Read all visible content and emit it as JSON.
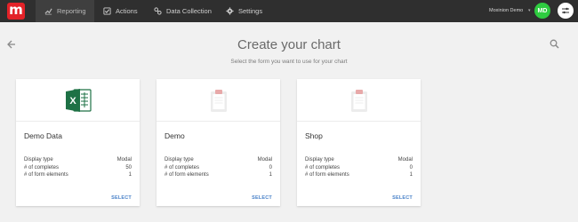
{
  "nav": {
    "logo_letter": "m",
    "tabs": [
      {
        "label": "Reporting",
        "icon": "chart-line-icon",
        "active": true
      },
      {
        "label": "Actions",
        "icon": "checkbox-icon",
        "active": false
      },
      {
        "label": "Data Collection",
        "icon": "link-icon",
        "active": false
      },
      {
        "label": "Settings",
        "icon": "gear-icon",
        "active": false
      }
    ],
    "user_name": "Moxinion Demo",
    "avatar_initials": "MD"
  },
  "header": {
    "title": "Create your chart",
    "subtitle": "Select the form you want to use for your chart"
  },
  "colors": {
    "topbar": "#2f2f2f",
    "logo": "#e32228",
    "avatar": "#2ecc40",
    "select_link": "#4a82c9",
    "excel_green": "#1e7145"
  },
  "cards": [
    {
      "title": "Demo Data",
      "icon": "excel-icon",
      "display_type_label": "Display type",
      "display_type_value": "Modal",
      "completes_label": "# of completes",
      "completes_value": "50",
      "elements_label": "# of form elements",
      "elements_value": "1",
      "select_label": "SELECT"
    },
    {
      "title": "Demo",
      "icon": "clipboard-icon",
      "display_type_label": "Display type",
      "display_type_value": "Modal",
      "completes_label": "# of completes",
      "completes_value": "0",
      "elements_label": "# of form elements",
      "elements_value": "1",
      "select_label": "SELECT"
    },
    {
      "title": "Shop",
      "icon": "clipboard-icon",
      "display_type_label": "Display type",
      "display_type_value": "Modal",
      "completes_label": "# of completes",
      "completes_value": "0",
      "elements_label": "# of form elements",
      "elements_value": "1",
      "select_label": "SELECT"
    }
  ]
}
